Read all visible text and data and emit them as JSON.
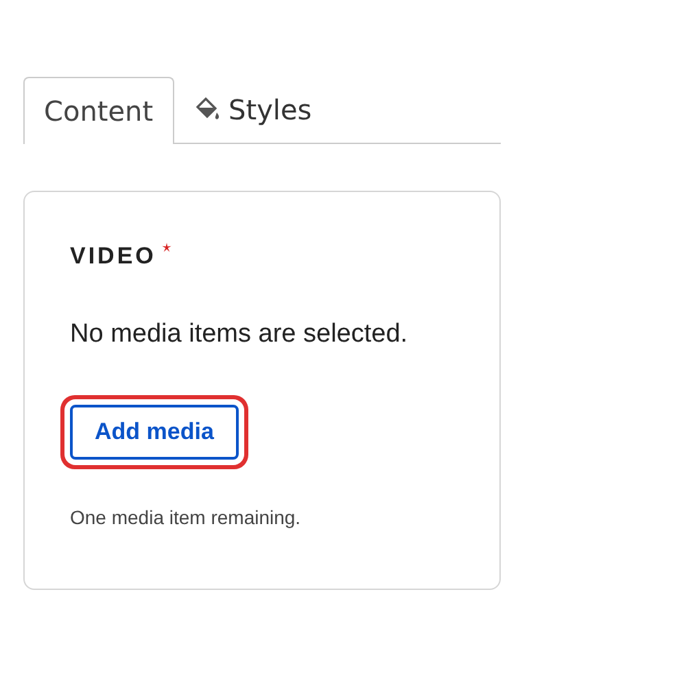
{
  "tabs": [
    {
      "label": "Content",
      "selected": true,
      "kind": "plain"
    },
    {
      "label": "Styles",
      "selected": false,
      "kind": "styles"
    }
  ],
  "field": {
    "label": "VIDEO",
    "required": true,
    "message": "No media items are selected.",
    "button": {
      "label": "Add media",
      "focused": true
    },
    "help": "One media item remaining."
  }
}
